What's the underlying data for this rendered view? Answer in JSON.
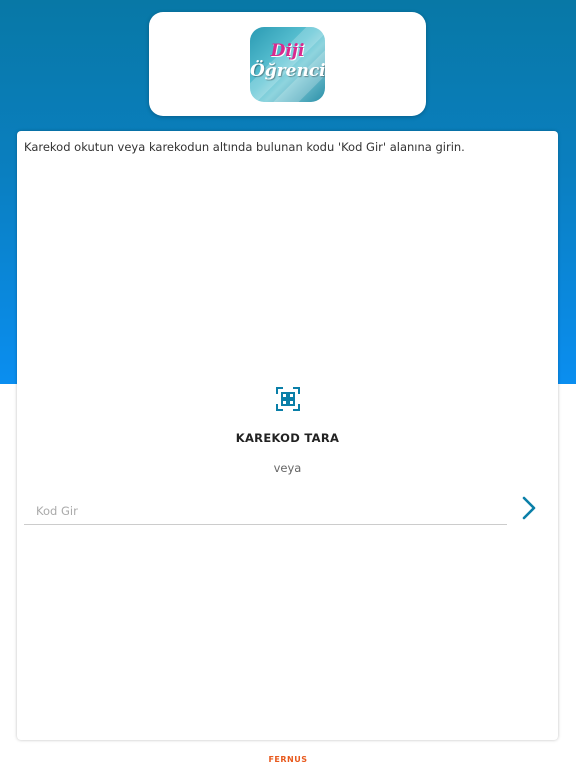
{
  "app": {
    "logo_line1": "Diji",
    "logo_line2": "Öğrenci"
  },
  "main": {
    "instruction": "Karekod okutun veya karekodun altında bulunan kodu 'Kod Gir' alanına girin.",
    "scan_icon": "qr-scan-icon",
    "scan_label": "KAREKOD TARA",
    "or_label": "veya",
    "code_placeholder": "Kod Gir",
    "code_value": "",
    "submit_icon": "chevron-right-icon"
  },
  "footer": {
    "brand": "FERNUS"
  },
  "colors": {
    "header_gradient_top": "#0878a6",
    "header_gradient_bottom": "#0a8ef0",
    "accent": "#0a7fa8",
    "brand_footer": "#e85a1e",
    "logo_pink": "#d92a8e"
  }
}
